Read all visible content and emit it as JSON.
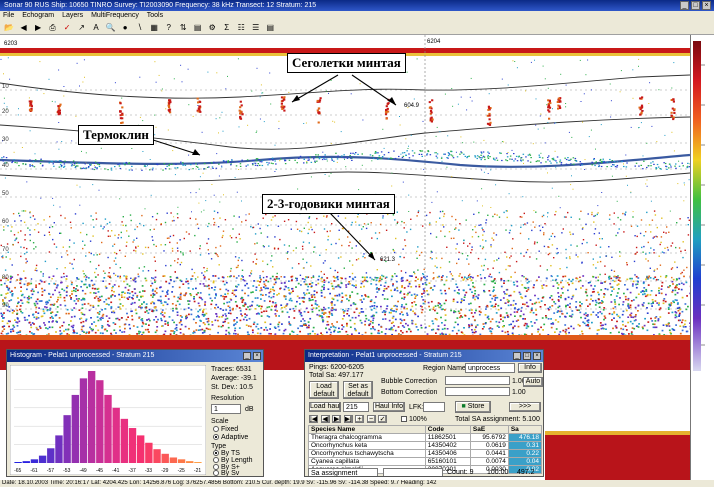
{
  "app": {
    "title": "Sonar 90 RUS  Ship: 10650 TINRO  Survey: TI2003090  Frequency: 38 kHz  Transect: 12  Stratum: 215",
    "window_buttons": [
      "_",
      "□",
      "×"
    ]
  },
  "menu": [
    "File",
    "Echogram",
    "Layers",
    "MultiFrequency",
    "Tools"
  ],
  "echogram": {
    "ping_left": "6203",
    "ping_mid": "6204",
    "depth_ticks": [
      "10",
      "20",
      "30",
      "40",
      "50",
      "60",
      "70",
      "80",
      "90"
    ],
    "point_labels": [
      "604.9",
      "621.3"
    ]
  },
  "callouts": {
    "juveniles": "Сеголетки минтая",
    "thermocline": "Термоклин",
    "age23": "2-3-годовики минтая"
  },
  "histogram": {
    "title": "Histogram - Pelat1 unprocessed - Stratum 215",
    "traces_label": "Traces:",
    "traces_value": "6531",
    "average_label": "Average:",
    "average_value": "-39.1",
    "stdev_label": "St. Dev.:",
    "stdev_value": "10.5",
    "resolution_label": "Resolution",
    "resolution_value": "1",
    "resolution_unit": "dB",
    "scale_label": "Scale",
    "scale_options": [
      "Fixed",
      "Adaptive"
    ],
    "type_label": "Type",
    "type_options": [
      "By TS",
      "By Length",
      "By S+",
      "By Sv"
    ],
    "x_ticks": [
      "-65",
      "-61",
      "-57",
      "-53",
      "-49",
      "-45",
      "-41",
      "-37",
      "-33",
      "-29",
      "-25",
      "-21"
    ]
  },
  "chart_data": {
    "type": "bar",
    "categories": [
      "-65",
      "-63",
      "-61",
      "-59",
      "-57",
      "-55",
      "-53",
      "-51",
      "-49",
      "-47",
      "-45",
      "-43",
      "-41",
      "-39",
      "-37",
      "-35",
      "-33",
      "-31",
      "-29",
      "-27",
      "-25",
      "-23",
      "-21"
    ],
    "values": [
      1,
      2,
      4,
      8,
      16,
      30,
      52,
      74,
      92,
      100,
      90,
      74,
      60,
      48,
      38,
      30,
      22,
      15,
      10,
      6,
      4,
      2,
      1
    ],
    "xlabel": "",
    "ylabel": "",
    "ylim": [
      0,
      100
    ],
    "colors": [
      "#1010e0",
      "#2a1fe0",
      "#3b2ad8",
      "#4d2fd0",
      "#5e30c8",
      "#7030c0",
      "#8230b8",
      "#9430b0",
      "#a630a8",
      "#b830a0",
      "#c83098",
      "#d53090",
      "#e03088",
      "#e83080",
      "#f03078",
      "#f53070",
      "#f83a68",
      "#fa4860",
      "#fb5858",
      "#fc6850",
      "#fd7848",
      "#fe8840",
      "#ff9838"
    ]
  },
  "interp": {
    "title": "Interpretation - Pelat1 unprocessed - Stratum 215",
    "pings_label": "Pings: 6200-6205",
    "total_sa_label": "Total Sa:",
    "total_sa_value": "497.177",
    "region_name_label": "Region Name",
    "region_name_value": "unprocess",
    "info_button": "Info",
    "load_default_button": "Load default",
    "set_default_button": "Set as default",
    "bubble_label": "Bubble Correction",
    "bottom_label": "Bottom Correction",
    "bubble_value": "1.00",
    "bottom_value": "1.00",
    "auto_button": "Auto",
    "load_haul_button": "Load haul",
    "haul_value": "215",
    "haul_info_button": "Haul Info",
    "lfk_label": "LFK:",
    "store_button": "Store",
    "next_button": ">>>",
    "pct_label": "100%",
    "total_sa_assign_label": "Total SA assignment:",
    "total_sa_assign_value": "5.100",
    "columns": [
      "Species Name",
      "Code",
      "SaE",
      "Sa"
    ],
    "rows": [
      {
        "name": "Theragra chalcogramma",
        "code": "11862501",
        "sae": "95.6792",
        "sa": "476.18"
      },
      {
        "name": "Oncorhynchus keta",
        "code": "14350402",
        "sae": "0.0619",
        "sa": "0.31"
      },
      {
        "name": "Oncorhynchus tschawytscha",
        "code": "14350406",
        "sae": "0.0441",
        "sa": "0.22"
      },
      {
        "name": "Cyanea capillata",
        "code": "65160101",
        "sae": "0.0074",
        "sa": "0.04"
      },
      {
        "name": "Aequorea gimoldii",
        "code": "30070201",
        "sae": "0.0030",
        "sa": "0.02"
      }
    ],
    "assign_label": "Sa assignment",
    "count_label": "Count: 9",
    "total_pct": "100.00",
    "total_sa": "497.2"
  },
  "status": "Date: 18.10.2003  Time: 20:16:17  Lat: 4204.425  Lon: 14256.876  Log: 376257.4856  Bottom: 210.5  Cur. depth: 19.9  Sv: -115.96  Sv: -114.38  Speed: 9.7  Heading: 142"
}
